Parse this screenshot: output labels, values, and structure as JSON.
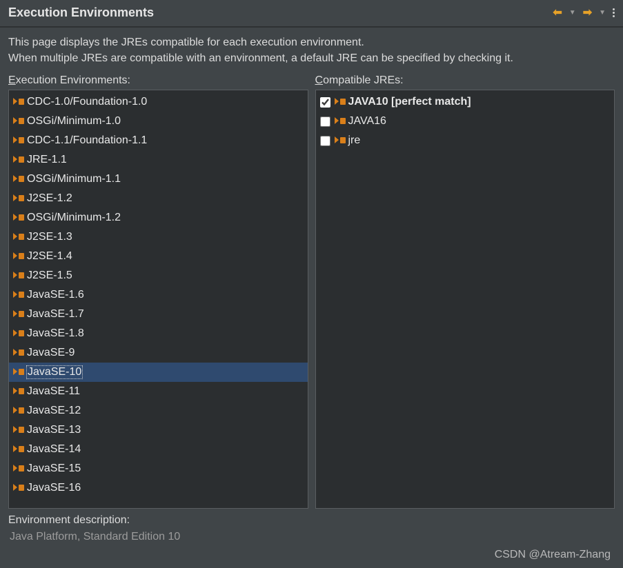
{
  "header": {
    "title": "Execution Environments"
  },
  "description": {
    "line1": "This page displays the JREs compatible for each execution environment.",
    "line2": "When multiple JREs are compatible with an environment, a default JRE can be specified by checking it."
  },
  "leftColumn": {
    "label_pre": "E",
    "label_rest": "xecution Environments:"
  },
  "rightColumn": {
    "label_pre": "C",
    "label_rest": "ompatible JREs:"
  },
  "environments": [
    {
      "name": "CDC-1.0/Foundation-1.0",
      "selected": false
    },
    {
      "name": "OSGi/Minimum-1.0",
      "selected": false
    },
    {
      "name": "CDC-1.1/Foundation-1.1",
      "selected": false
    },
    {
      "name": "JRE-1.1",
      "selected": false
    },
    {
      "name": "OSGi/Minimum-1.1",
      "selected": false
    },
    {
      "name": "J2SE-1.2",
      "selected": false
    },
    {
      "name": "OSGi/Minimum-1.2",
      "selected": false
    },
    {
      "name": "J2SE-1.3",
      "selected": false
    },
    {
      "name": "J2SE-1.4",
      "selected": false
    },
    {
      "name": "J2SE-1.5",
      "selected": false
    },
    {
      "name": "JavaSE-1.6",
      "selected": false
    },
    {
      "name": "JavaSE-1.7",
      "selected": false
    },
    {
      "name": "JavaSE-1.8",
      "selected": false
    },
    {
      "name": "JavaSE-9",
      "selected": false
    },
    {
      "name": "JavaSE-10",
      "selected": true
    },
    {
      "name": "JavaSE-11",
      "selected": false
    },
    {
      "name": "JavaSE-12",
      "selected": false
    },
    {
      "name": "JavaSE-13",
      "selected": false
    },
    {
      "name": "JavaSE-14",
      "selected": false
    },
    {
      "name": "JavaSE-15",
      "selected": false
    },
    {
      "name": "JavaSE-16",
      "selected": false
    }
  ],
  "compatibleJres": [
    {
      "name": "JAVA10 [perfect match]",
      "checked": true,
      "bold": true
    },
    {
      "name": "JAVA16",
      "checked": false,
      "bold": false
    },
    {
      "name": "jre",
      "checked": false,
      "bold": false
    }
  ],
  "envDescription": {
    "label": "Environment description:",
    "value": "Java Platform, Standard Edition 10"
  },
  "watermark": "CSDN @Atream-Zhang"
}
